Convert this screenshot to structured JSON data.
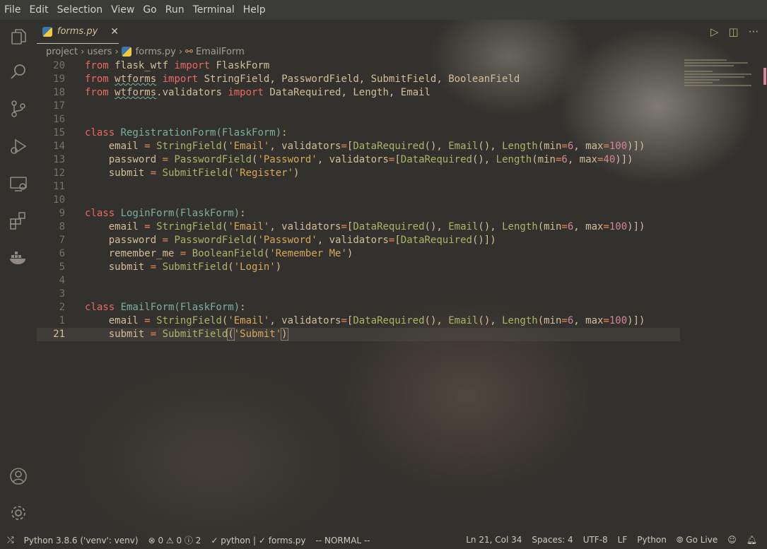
{
  "menu": [
    "File",
    "Edit",
    "Selection",
    "View",
    "Go",
    "Run",
    "Terminal",
    "Help"
  ],
  "tab": {
    "title": "forms.py",
    "close": "✕"
  },
  "breadcrumb": [
    "project",
    "users",
    "forms.py",
    "EmailForm"
  ],
  "top_icons": [
    "run-icon",
    "split-editor-icon",
    "more-icon"
  ],
  "colors": {
    "keyword": "#ea6962",
    "class": "#7daea3",
    "function": "#a9b665",
    "string": "#d8a657",
    "operator": "#e78a4e",
    "number": "#d3869b",
    "text": "#d4be98"
  },
  "code": [
    {
      "n": "20",
      "t": [
        [
          "from ",
          "kw"
        ],
        [
          "flask_wtf ",
          ""
        ],
        [
          "import ",
          "kw"
        ],
        [
          "FlaskForm",
          ""
        ]
      ]
    },
    {
      "n": "19",
      "t": [
        [
          "from ",
          "kw"
        ],
        [
          "wtforms",
          "sq"
        ],
        [
          " ",
          ""
        ],
        [
          "import ",
          "kw"
        ],
        [
          "StringField, PasswordField, SubmitField, BooleanField",
          ""
        ]
      ]
    },
    {
      "n": "18",
      "t": [
        [
          "from ",
          "kw"
        ],
        [
          "wtforms",
          "sq"
        ],
        [
          ".validators ",
          ""
        ],
        [
          "import ",
          "kw"
        ],
        [
          "DataRequired, Length, Email",
          ""
        ]
      ]
    },
    {
      "n": "17",
      "t": []
    },
    {
      "n": "16",
      "t": []
    },
    {
      "n": "15",
      "t": [
        [
          "class ",
          "kw"
        ],
        [
          "RegistrationForm(FlaskForm)",
          "cls"
        ],
        [
          ":",
          ""
        ]
      ]
    },
    {
      "n": "14",
      "t": [
        [
          "    email ",
          ""
        ],
        [
          "= ",
          "op"
        ],
        [
          "StringField",
          "fn"
        ],
        [
          "(",
          ""
        ],
        [
          "'Email'",
          "str"
        ],
        [
          ", validators",
          ""
        ],
        [
          "=",
          "op"
        ],
        [
          "[",
          ""
        ],
        [
          "DataRequired",
          "fn"
        ],
        [
          "(), ",
          ""
        ],
        [
          "Email",
          "fn"
        ],
        [
          "(), ",
          ""
        ],
        [
          "Length",
          "fn"
        ],
        [
          "(min",
          ""
        ],
        [
          "=",
          "op"
        ],
        [
          "6",
          "num"
        ],
        [
          ", max",
          ""
        ],
        [
          "=",
          "op"
        ],
        [
          "100",
          "num"
        ],
        [
          ")])",
          ""
        ]
      ]
    },
    {
      "n": "13",
      "t": [
        [
          "    password ",
          ""
        ],
        [
          "= ",
          "op"
        ],
        [
          "PasswordField",
          "fn"
        ],
        [
          "(",
          ""
        ],
        [
          "'Password'",
          "str"
        ],
        [
          ", validators",
          ""
        ],
        [
          "=",
          "op"
        ],
        [
          "[",
          ""
        ],
        [
          "DataRequired",
          "fn"
        ],
        [
          "(), ",
          ""
        ],
        [
          "Length",
          "fn"
        ],
        [
          "(min",
          ""
        ],
        [
          "=",
          "op"
        ],
        [
          "6",
          "num"
        ],
        [
          ", max",
          ""
        ],
        [
          "=",
          "op"
        ],
        [
          "40",
          "num"
        ],
        [
          ")])",
          ""
        ]
      ]
    },
    {
      "n": "12",
      "t": [
        [
          "    submit ",
          ""
        ],
        [
          "= ",
          "op"
        ],
        [
          "SubmitField",
          "fn"
        ],
        [
          "(",
          ""
        ],
        [
          "'Register'",
          "str"
        ],
        [
          ")",
          ""
        ]
      ]
    },
    {
      "n": "11",
      "t": []
    },
    {
      "n": "10",
      "t": []
    },
    {
      "n": "9",
      "t": [
        [
          "class ",
          "kw"
        ],
        [
          "LoginForm(FlaskForm)",
          "cls"
        ],
        [
          ":",
          ""
        ]
      ]
    },
    {
      "n": "8",
      "t": [
        [
          "    email ",
          ""
        ],
        [
          "= ",
          "op"
        ],
        [
          "StringField",
          "fn"
        ],
        [
          "(",
          ""
        ],
        [
          "'Email'",
          "str"
        ],
        [
          ", validators",
          ""
        ],
        [
          "=",
          "op"
        ],
        [
          "[",
          ""
        ],
        [
          "DataRequired",
          "fn"
        ],
        [
          "(), ",
          ""
        ],
        [
          "Email",
          "fn"
        ],
        [
          "(), ",
          ""
        ],
        [
          "Length",
          "fn"
        ],
        [
          "(min",
          ""
        ],
        [
          "=",
          "op"
        ],
        [
          "6",
          "num"
        ],
        [
          ", max",
          ""
        ],
        [
          "=",
          "op"
        ],
        [
          "100",
          "num"
        ],
        [
          ")])",
          ""
        ]
      ]
    },
    {
      "n": "7",
      "t": [
        [
          "    password ",
          ""
        ],
        [
          "= ",
          "op"
        ],
        [
          "PasswordField",
          "fn"
        ],
        [
          "(",
          ""
        ],
        [
          "'Password'",
          "str"
        ],
        [
          ", validators",
          ""
        ],
        [
          "=",
          "op"
        ],
        [
          "[",
          ""
        ],
        [
          "DataRequired",
          "fn"
        ],
        [
          "()])",
          ""
        ]
      ]
    },
    {
      "n": "6",
      "t": [
        [
          "    remember_me ",
          ""
        ],
        [
          "= ",
          "op"
        ],
        [
          "BooleanField",
          "fn"
        ],
        [
          "(",
          ""
        ],
        [
          "'Remember Me'",
          "str"
        ],
        [
          ")",
          ""
        ]
      ]
    },
    {
      "n": "5",
      "t": [
        [
          "    submit ",
          ""
        ],
        [
          "= ",
          "op"
        ],
        [
          "SubmitField",
          "fn"
        ],
        [
          "(",
          ""
        ],
        [
          "'Login'",
          "str"
        ],
        [
          ")",
          ""
        ]
      ]
    },
    {
      "n": "4",
      "t": []
    },
    {
      "n": "3",
      "t": []
    },
    {
      "n": "2",
      "t": [
        [
          "class ",
          "kw"
        ],
        [
          "EmailForm(FlaskForm)",
          "cls"
        ],
        [
          ":",
          ""
        ]
      ]
    },
    {
      "n": "1",
      "t": [
        [
          "    email ",
          ""
        ],
        [
          "= ",
          "op"
        ],
        [
          "StringField",
          "fn"
        ],
        [
          "(",
          ""
        ],
        [
          "'Email'",
          "str"
        ],
        [
          ", validators",
          ""
        ],
        [
          "=",
          "op"
        ],
        [
          "[",
          ""
        ],
        [
          "DataRequired",
          "fn"
        ],
        [
          "(), ",
          ""
        ],
        [
          "Email",
          "fn"
        ],
        [
          "(), ",
          ""
        ],
        [
          "Length",
          "fn"
        ],
        [
          "(min",
          ""
        ],
        [
          "=",
          "op"
        ],
        [
          "6",
          "num"
        ],
        [
          ", max",
          ""
        ],
        [
          "=",
          "op"
        ],
        [
          "100",
          "num"
        ],
        [
          ")])",
          ""
        ]
      ]
    },
    {
      "n": "21",
      "cur": true,
      "t": [
        [
          "    submit ",
          ""
        ],
        [
          "= ",
          "op"
        ],
        [
          "SubmitField",
          "fn"
        ],
        [
          "(",
          "br"
        ],
        [
          "'Submit'",
          "str"
        ],
        [
          ")",
          "br"
        ]
      ]
    }
  ],
  "status": {
    "branch_icon": "remote-icon",
    "interpreter": "Python 3.8.6 ('venv': venv)",
    "problems": "⊗ 0 ⚠ 0 ⓘ 2",
    "lint": "✓ python | ✓ forms.py",
    "mode": "-- NORMAL --",
    "position": "Ln 21, Col 34",
    "spaces": "Spaces: 4",
    "encoding": "UTF-8",
    "eol": "LF",
    "language": "Python",
    "golive": "⦾ Go Live",
    "feedback_icon": "feedback-icon",
    "bell_icon": "bell-icon"
  }
}
